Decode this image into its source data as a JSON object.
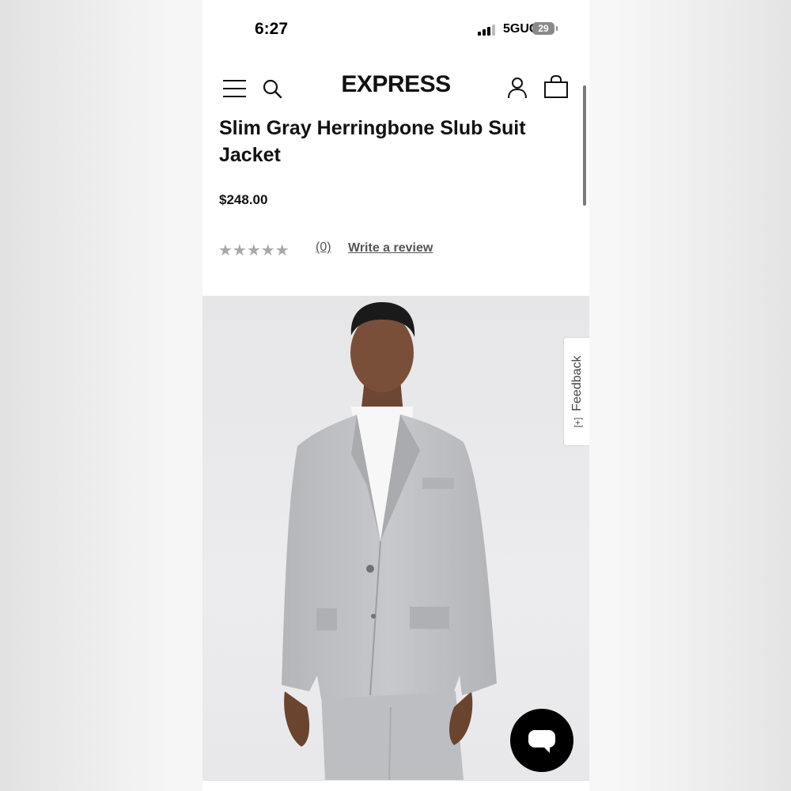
{
  "status_bar": {
    "time": "6:27",
    "network": "5GUC",
    "battery": "29"
  },
  "header": {
    "logo": "EXPRESS",
    "icons": [
      "menu-icon",
      "search-icon",
      "account-icon",
      "shopping-bag-icon"
    ]
  },
  "product": {
    "title": "Slim Gray Herringbone Slub Suit Jacket",
    "price": "$248.00",
    "rating_stars": "★★★★★",
    "rating_value": 0,
    "review_count": "(0)",
    "write_review": "Write a review"
  },
  "feedback": {
    "label": "Feedback",
    "icon": "[+]"
  },
  "colors": {
    "text": "#111111",
    "muted": "#555555",
    "star_empty": "#a8a8a8",
    "suit_gray": "#bfc1c4",
    "chat_button": "#000000"
  }
}
